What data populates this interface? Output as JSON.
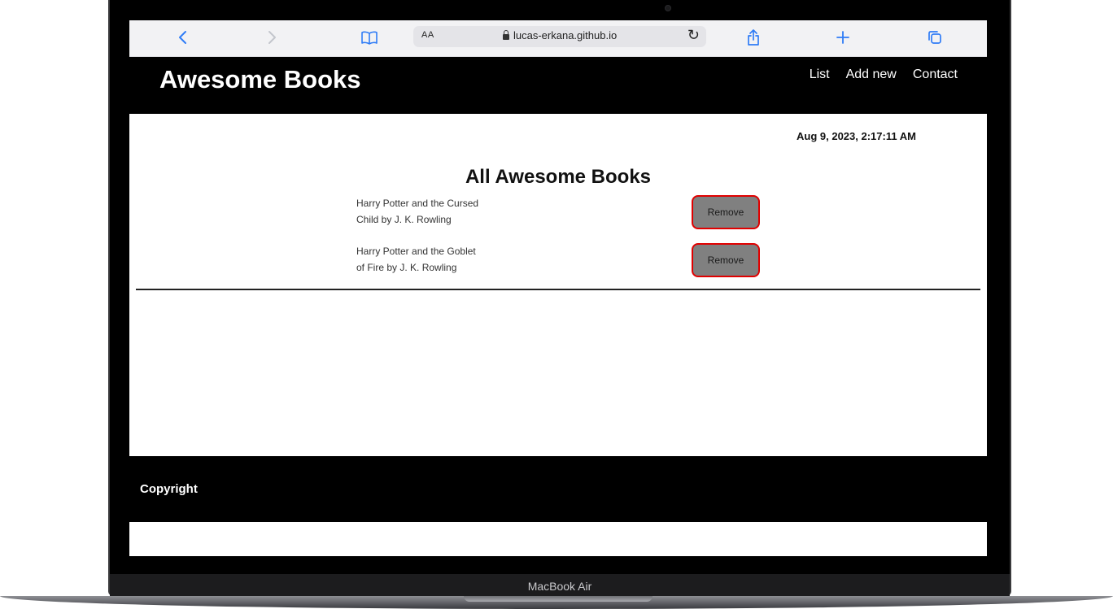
{
  "device": {
    "label": "MacBook Air"
  },
  "browser": {
    "text_size_label": "AA",
    "url": "lucas-erkana.github.io",
    "icons": {
      "back": "chevron-left-icon",
      "forward": "chevron-right-icon",
      "bookmarks": "book-icon",
      "lock": "lock-icon",
      "reload": "reload-icon",
      "share": "share-icon",
      "new_tab": "plus-icon",
      "tabs": "tabs-icon"
    },
    "accent_color": "#2f7cf6"
  },
  "header": {
    "title": "Awesome Books",
    "nav": [
      {
        "label": "List"
      },
      {
        "label": "Add new"
      },
      {
        "label": "Contact"
      }
    ]
  },
  "main": {
    "datetime": "Aug 9, 2023, 2:17:11 AM",
    "section_title": "All Awesome Books",
    "books": [
      {
        "line1": "Harry Potter and the Cursed",
        "line2": "Child by J. K. Rowling",
        "remove_label": "Remove"
      },
      {
        "line1": "Harry Potter and the Goblet",
        "line2": "of Fire by J. K. Rowling",
        "remove_label": "Remove"
      }
    ],
    "remove_button_colors": {
      "fill": "#808080",
      "border": "#e00000"
    }
  },
  "footer": {
    "copyright": "Copyright"
  }
}
